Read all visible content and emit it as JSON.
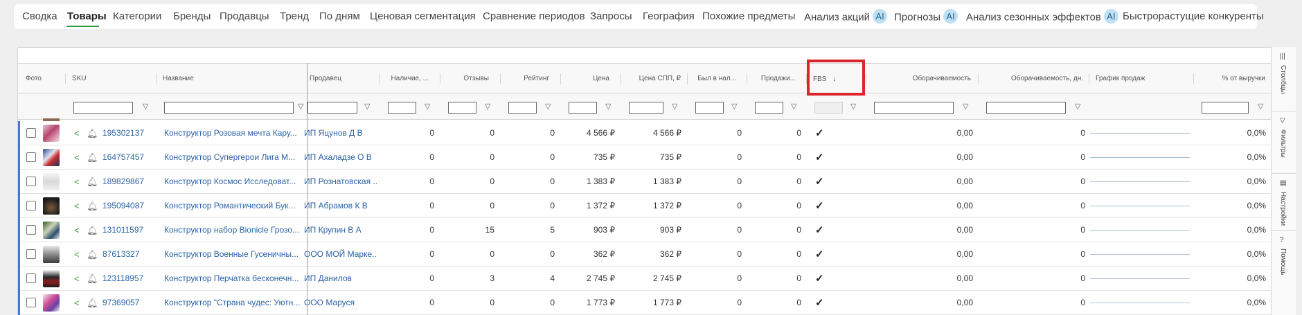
{
  "tabs": [
    {
      "label": "Сводка",
      "ai": false
    },
    {
      "label": "Товары",
      "ai": false,
      "active": true
    },
    {
      "label": "Категории",
      "ai": false
    },
    {
      "label": "Бренды",
      "ai": false
    },
    {
      "label": "Продавцы",
      "ai": false
    },
    {
      "label": "Тренд",
      "ai": false
    },
    {
      "label": "По дням",
      "ai": false
    },
    {
      "label": "Ценовая сегментация",
      "ai": false
    },
    {
      "label": "Сравнение периодов",
      "ai": false
    },
    {
      "label": "Запросы",
      "ai": false
    },
    {
      "label": "География",
      "ai": false
    },
    {
      "label": "Похожие предметы",
      "ai": false
    },
    {
      "label": "Анализ акций",
      "ai": true
    },
    {
      "label": "Прогнозы",
      "ai": true
    },
    {
      "label": "Анализ сезонных эффектов",
      "ai": true
    },
    {
      "label": "Быстрорастущие конкуренты",
      "ai": false
    }
  ],
  "ai_badge": "AI",
  "columns": {
    "photo": "Фото",
    "sku": "SKU",
    "name": "Название",
    "seller": "Продавец",
    "stock": "Наличие, ...",
    "reviews": "Отзывы",
    "rating": "Рейтинг",
    "price": "Цена",
    "spp_price": "Цена СПП, ₽",
    "was_in_stock": "Был в нал...",
    "sales": "Продажи...",
    "fbs": "FBS",
    "fbs_sort_icon": "↓",
    "turnover": "Оборачиваемость",
    "turnover_days": "Оборачиваемость, дн.",
    "sales_chart": "График продаж",
    "revenue_pct": "% от выручки"
  },
  "filter_icon": "funnel-icon",
  "rows": [
    {
      "sku": "195302137",
      "name": "Конструктор Розовая мечта Кару...",
      "seller": "ИП Яцунов Д В",
      "stock": "0",
      "reviews": "0",
      "rating": "0",
      "price": "4 566 ₽",
      "spp_price": "4 566 ₽",
      "was_in_stock": "0",
      "sales": "0",
      "turnover": "0,00",
      "turnover_days": "0",
      "revenue_pct": "0,0%"
    },
    {
      "sku": "164757457",
      "name": "Конструктор Супергерои Лига М...",
      "seller": "ИП Ахаладзе О В",
      "stock": "0",
      "reviews": "0",
      "rating": "0",
      "price": "735 ₽",
      "spp_price": "735 ₽",
      "was_in_stock": "0",
      "sales": "0",
      "turnover": "0,00",
      "turnover_days": "0",
      "revenue_pct": "0,0%"
    },
    {
      "sku": "189829867",
      "name": "Конструктор Космос Исследоват...",
      "seller": "ИП Рознатовская ...",
      "stock": "0",
      "reviews": "0",
      "rating": "0",
      "price": "1 383 ₽",
      "spp_price": "1 383 ₽",
      "was_in_stock": "0",
      "sales": "0",
      "turnover": "0,00",
      "turnover_days": "0",
      "revenue_pct": "0,0%"
    },
    {
      "sku": "195094087",
      "name": "Конструктор Романтический Бук...",
      "seller": "ИП Абрамов К В",
      "stock": "0",
      "reviews": "0",
      "rating": "0",
      "price": "1 372 ₽",
      "spp_price": "1 372 ₽",
      "was_in_stock": "0",
      "sales": "0",
      "turnover": "0,00",
      "turnover_days": "0",
      "revenue_pct": "0,0%"
    },
    {
      "sku": "131011597",
      "name": "Конструктор набор Bionicle Грозо...",
      "seller": "ИП Крупин В А",
      "stock": "0",
      "reviews": "15",
      "rating": "5",
      "price": "903 ₽",
      "spp_price": "903 ₽",
      "was_in_stock": "0",
      "sales": "0",
      "turnover": "0,00",
      "turnover_days": "0",
      "revenue_pct": "0,0%"
    },
    {
      "sku": "87613327",
      "name": "Конструктор Военные Гусеничны...",
      "seller": "ООО МОЙ Марке...",
      "stock": "0",
      "reviews": "0",
      "rating": "0",
      "price": "362 ₽",
      "spp_price": "362 ₽",
      "was_in_stock": "0",
      "sales": "0",
      "turnover": "0,00",
      "turnover_days": "0",
      "revenue_pct": "0,0%"
    },
    {
      "sku": "123118957",
      "name": "Конструктор Перчатка бесконечн...",
      "seller": "ИП Данилов",
      "stock": "0",
      "reviews": "3",
      "rating": "4",
      "price": "2 745 ₽",
      "spp_price": "2 745 ₽",
      "was_in_stock": "0",
      "sales": "0",
      "turnover": "0,00",
      "turnover_days": "0",
      "revenue_pct": "0,0%"
    },
    {
      "sku": "97369057",
      "name": "Конструктор \"Страна чудес: Уютн...",
      "seller": "ООО Маруся",
      "stock": "0",
      "reviews": "0",
      "rating": "0",
      "price": "1 773 ₽",
      "spp_price": "1 773 ₽",
      "was_in_stock": "0",
      "sales": "0",
      "turnover": "0,00",
      "turnover_days": "0",
      "revenue_pct": "0,0%"
    }
  ],
  "sidebar": [
    {
      "label": "Столбцы",
      "icon": "columns-icon"
    },
    {
      "label": "Фильтры",
      "icon": "filter-icon"
    },
    {
      "label": "Настройки",
      "icon": "settings-icon"
    },
    {
      "label": "Помощь",
      "icon": "help-icon"
    }
  ],
  "colors": {
    "accent": "#3a9a47",
    "link": "#2a63a8",
    "highlight": "#d9262b",
    "row_bar": "#4a78c8"
  }
}
